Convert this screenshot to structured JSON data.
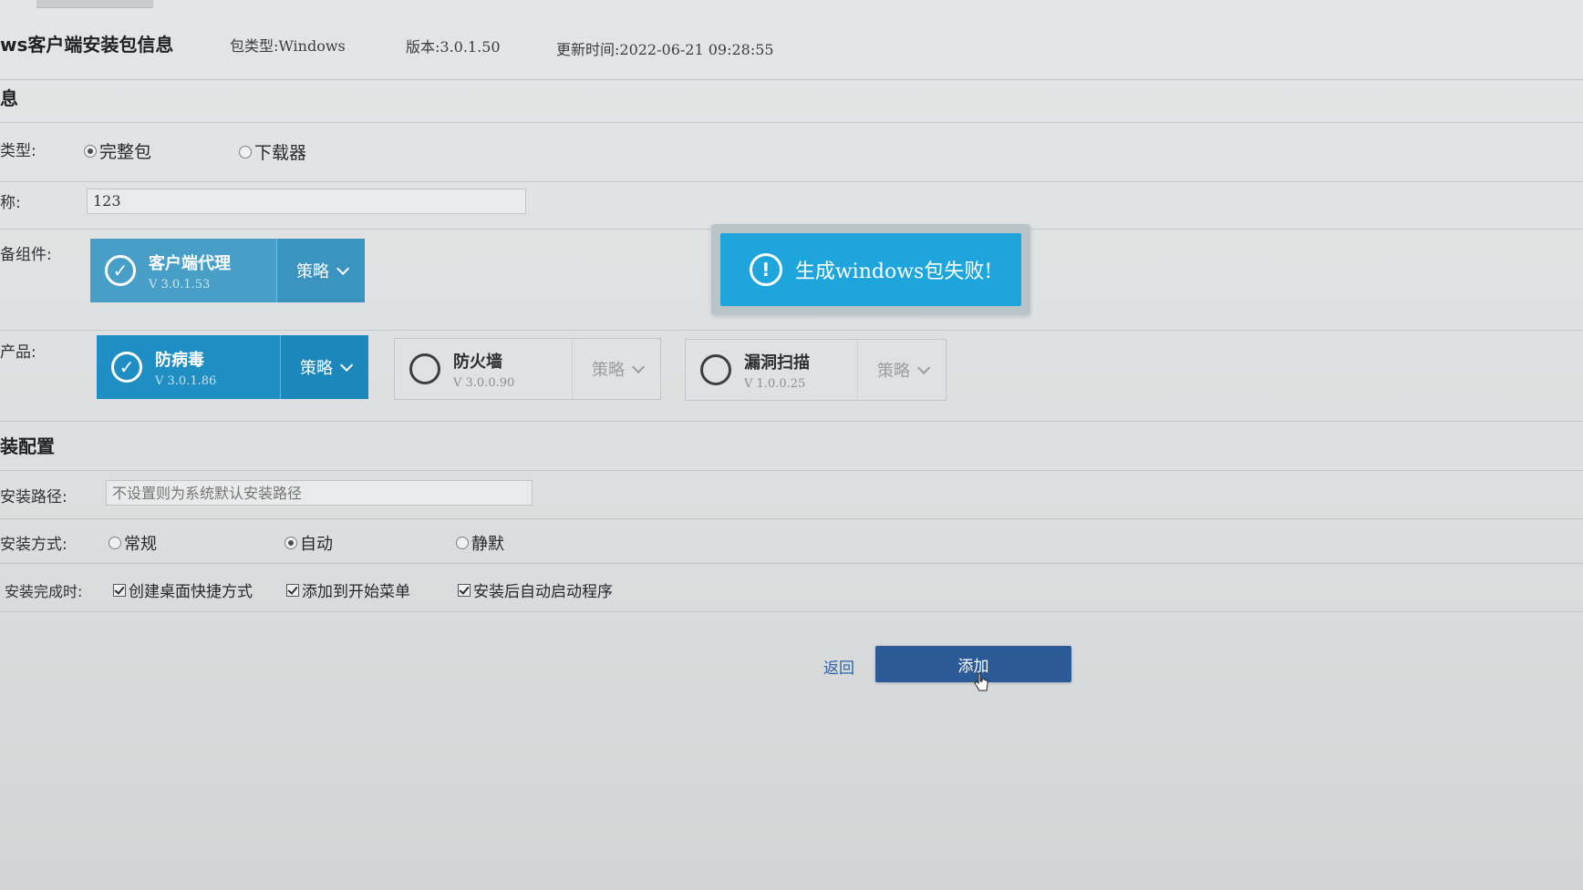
{
  "header": {
    "title": "ws客户端安装包信息",
    "package_type": "包类型:Windows",
    "version": "版本:3.0.1.50",
    "updated": "更新时间:2022-06-21 09:28:55"
  },
  "basic_section": {
    "title": "息",
    "type_label": "类型:",
    "type_options": [
      {
        "label": "完整包",
        "selected": true
      },
      {
        "label": "下载器",
        "selected": false
      }
    ],
    "name_label": "称:",
    "name_value": "123",
    "component_label": "备组件:",
    "component": {
      "name": "客户端代理",
      "version": "V 3.0.1.53",
      "policy": "策略",
      "checked": true
    },
    "product_label": "产品:",
    "products": [
      {
        "name": "防病毒",
        "version": "V 3.0.1.86",
        "policy": "策略",
        "checked": true
      },
      {
        "name": "防火墙",
        "version": "V 3.0.0.90",
        "policy": "策略",
        "checked": false
      },
      {
        "name": "漏洞扫描",
        "version": "V 1.0.0.25",
        "policy": "策略",
        "checked": false
      }
    ]
  },
  "toast": {
    "message": "生成windows包失败!",
    "icon": "exclamation-icon",
    "color": "#1ea6dc"
  },
  "install_section": {
    "title": "装配置",
    "path_label": "安装路径:",
    "path_placeholder": "不设置则为系统默认安装路径",
    "mode_label": "安装方式:",
    "mode_options": [
      {
        "label": "常规",
        "selected": false
      },
      {
        "label": "自动",
        "selected": true
      },
      {
        "label": "静默",
        "selected": false
      }
    ],
    "finish_label": "安装完成时:",
    "finish_options": [
      {
        "label": "创建桌面快捷方式",
        "checked": true
      },
      {
        "label": "添加到开始菜单",
        "checked": true
      },
      {
        "label": "安装后自动启动程序",
        "checked": true
      }
    ]
  },
  "actions": {
    "back_label": "返回",
    "add_label": "添加",
    "primary_color": "#2c5a96"
  }
}
